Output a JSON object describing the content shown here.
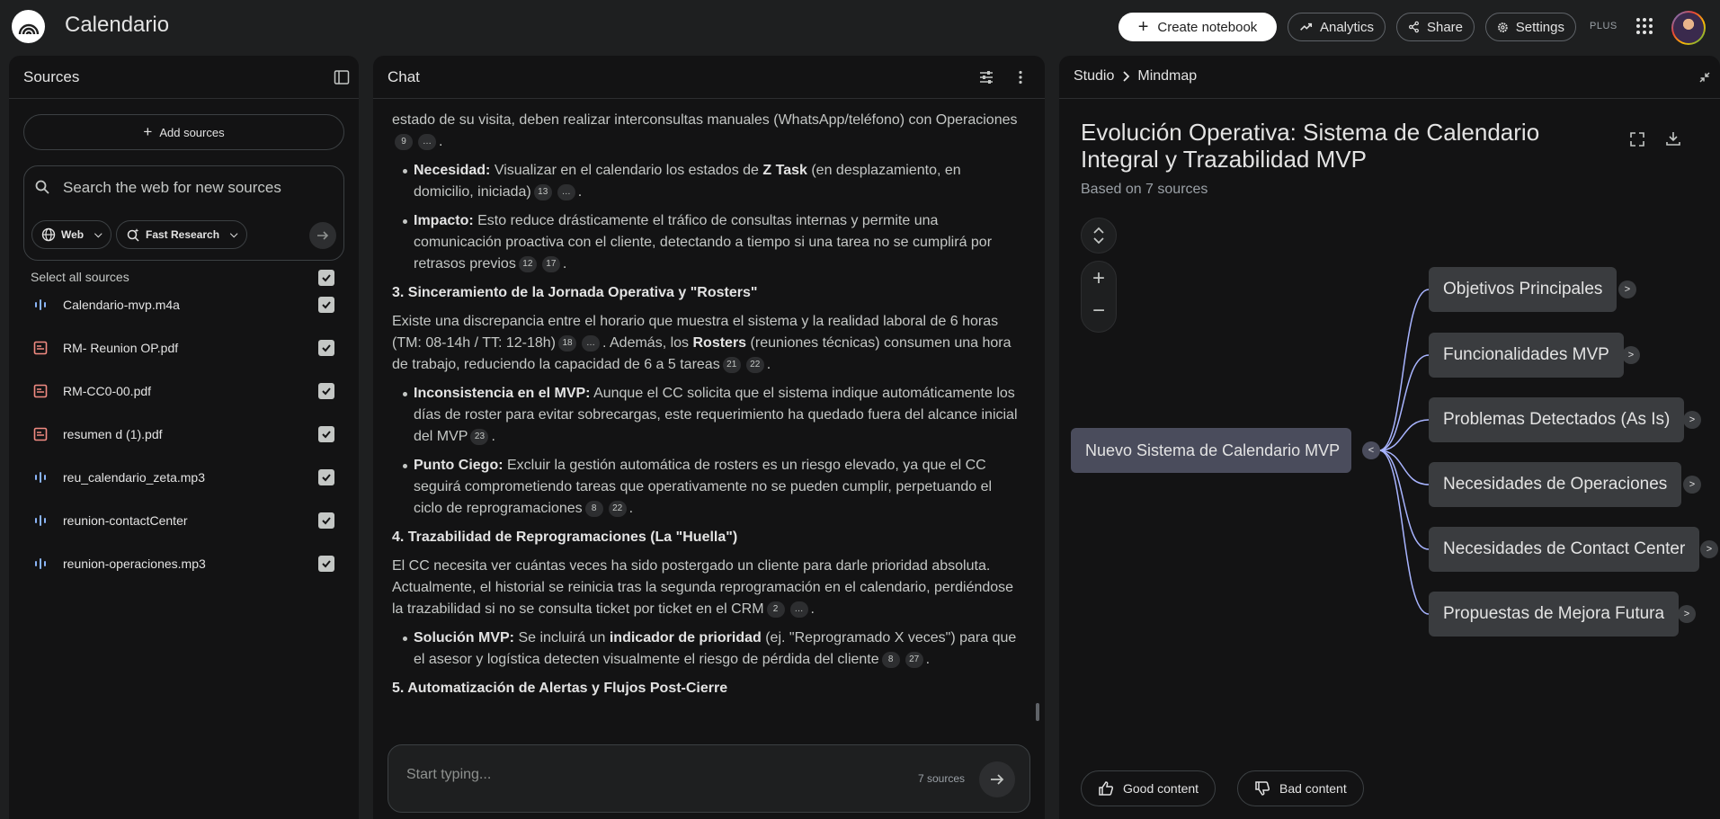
{
  "app": {
    "title": "Calendario"
  },
  "topbar": {
    "create_label": "Create notebook",
    "analytics_label": "Analytics",
    "share_label": "Share",
    "settings_label": "Settings",
    "plan_badge": "PLUS"
  },
  "sources": {
    "title": "Sources",
    "add_label": "Add sources",
    "search_placeholder": "Search the web for new sources",
    "web_chip": "Web",
    "research_chip": "Fast Research",
    "select_all": "Select all sources",
    "items": [
      {
        "label": "Calendario-mvp.m4a",
        "icon": "audio-icon"
      },
      {
        "label": "RM- Reunion OP.pdf",
        "icon": "pdf-icon"
      },
      {
        "label": "RM-CC0-00.pdf",
        "icon": "pdf-icon"
      },
      {
        "label": "resumen d (1).pdf",
        "icon": "pdf-icon"
      },
      {
        "label": "reu_calendario_zeta.mp3",
        "icon": "audio-icon"
      },
      {
        "label": "reunion-contactCenter",
        "icon": "audio-icon"
      },
      {
        "label": "reunion-operaciones.mp3",
        "icon": "audio-icon"
      }
    ]
  },
  "chat": {
    "title": "Chat",
    "p0_text": "estado de su visita, deben realizar interconsultas manuales (WhatsApp/teléfono) con Operaciones",
    "p0_cites": [
      "9",
      "…"
    ],
    "b1_title": "Necesidad:",
    "b1_text_a": "Visualizar en el calendario los estados de",
    "b1_bold": "Z Task",
    "b1_text_b": "(en desplazamiento, en domicilio, iniciada)",
    "b1_cites": [
      "13",
      "…"
    ],
    "b2_title": "Impacto:",
    "b2_text": "Esto reduce drásticamente el tráfico de consultas internas y permite una comunicación proactiva con el cliente, detectando a tiempo si una tarea no se cumplirá por retrasos previos",
    "b2_cites": [
      "12",
      "17"
    ],
    "h3": "3. Sinceramiento de la Jornada Operativa y \"Rosters\"",
    "p3_text_a": "Existe una discrepancia entre el horario que muestra el sistema y la realidad laboral de 6 horas (TM: 08-14h / TT: 12-18h)",
    "p3_cites_a": [
      "18",
      "…"
    ],
    "p3_text_b": ". Además, los",
    "p3_bold": "Rosters",
    "p3_text_c": "(reuniones técnicas) consumen una hora de trabajo, reduciendo la capacidad de 6 a 5 tareas",
    "p3_cites_b": [
      "21",
      "22"
    ],
    "b3_title": "Inconsistencia en el MVP:",
    "b3_text": "Aunque el CC solicita que el sistema indique automáticamente los días de roster para evitar sobrecargas, este requerimiento ha quedado fuera del alcance inicial del MVP",
    "b3_cites": [
      "23"
    ],
    "b4_title": "Punto Ciego:",
    "b4_text": "Excluir la gestión automática de rosters es un riesgo elevado, ya que el CC seguirá comprometiendo tareas que operativamente no se pueden cumplir, perpetuando el ciclo de reprogramaciones",
    "b4_cites": [
      "8",
      "22"
    ],
    "h4": "4. Trazabilidad de Reprogramaciones (La \"Huella\")",
    "p4_text": "El CC necesita ver cuántas veces ha sido postergado un cliente para darle prioridad absoluta. Actualmente, el historial se reinicia tras la segunda reprogramación en el calendario, perdiéndose la trazabilidad si no se consulta ticket por ticket en el CRM",
    "p4_cites": [
      "2",
      "…"
    ],
    "b5_title": "Solución MVP:",
    "b5_text_a": "Se incluirá un",
    "b5_bold": "indicador de prioridad",
    "b5_text_b": "(ej. \"Reprogramado X veces\") para que el asesor y logística detecten visualmente el riesgo de pérdida del cliente",
    "b5_cites": [
      "8",
      "27"
    ],
    "h5": "5. Automatización de Alertas y Flujos Post-Cierre",
    "input_placeholder": "Start typing...",
    "source_count": "7 sources"
  },
  "studio": {
    "crumb_root": "Studio",
    "crumb_leaf": "Mindmap",
    "title": "Evolución Operativa: Sistema de Calendario Integral y Trazabilidad MVP",
    "subtitle": "Based on 7 sources",
    "root_node": "Nuevo Sistema de Calendario MVP",
    "collapse_glyph": "<",
    "expand_glyph": ">",
    "nodes": [
      "Objetivos Principales",
      "Funcionalidades MVP",
      "Problemas Detectados (As Is)",
      "Necesidades de Operaciones",
      "Necesidades de Contact Center",
      "Propuestas de Mejora Futura"
    ],
    "good_label": "Good content",
    "bad_label": "Bad content"
  },
  "colors": {
    "background": "#1e1f20",
    "panel": "#131314",
    "root_node": "#4a4c5c",
    "child_node": "#3a3c3f",
    "connector": "#a8b4ff",
    "audio_icon": "#8ab4f8",
    "pdf_icon": "#f28b82"
  }
}
